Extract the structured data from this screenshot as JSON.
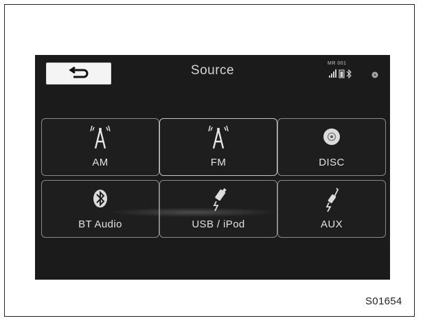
{
  "screen": {
    "title": "Source",
    "back_button": {
      "icon": "return-arrow-icon"
    },
    "status": {
      "label": "MR 001",
      "icons": [
        "signal-strength-icon",
        "battery-icon",
        "bluetooth-icon",
        "settings-dot-icon"
      ]
    },
    "sources": [
      {
        "label": "AM",
        "icon": "radio-antenna-icon"
      },
      {
        "label": "FM",
        "icon": "radio-antenna-icon"
      },
      {
        "label": "DISC",
        "icon": "disc-icon"
      },
      {
        "label": "BT Audio",
        "icon": "bluetooth-icon"
      },
      {
        "label": "USB / iPod",
        "icon": "usb-plug-icon"
      },
      {
        "label": "AUX",
        "icon": "aux-plug-icon"
      }
    ]
  },
  "figure_code": "S01654",
  "colors": {
    "screen_bg": "#1b1b1b",
    "tile_border": "#8a8a8a",
    "text": "#e2e2e2"
  }
}
